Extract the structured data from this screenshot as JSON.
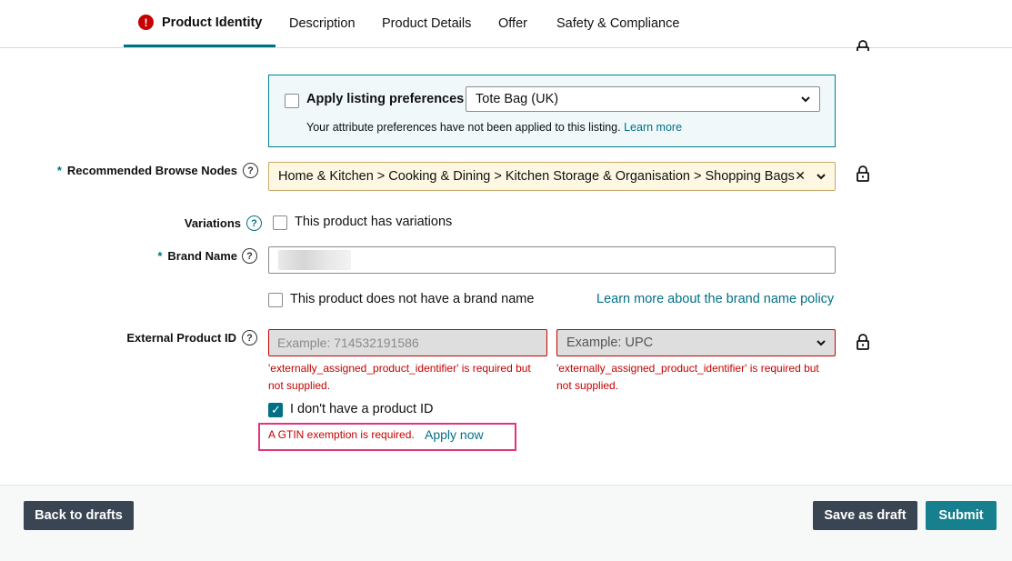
{
  "tabs": [
    {
      "label": "Product Identity",
      "active": true,
      "has_error": true
    },
    {
      "label": "Description"
    },
    {
      "label": "Product Details"
    },
    {
      "label": "Offer"
    },
    {
      "label": "Safety & Compliance"
    }
  ],
  "tab_error_glyph": "!",
  "preferences": {
    "checkbox_label": "Apply listing preferences",
    "selected": "Tote Bag (UK)",
    "note": "Your attribute preferences have not been applied to this listing.",
    "learn_more": "Learn more"
  },
  "browse_nodes": {
    "label": "Recommended Browse Nodes",
    "required_mark": "*",
    "value": "Home & Kitchen > Cooking & Dining > Kitchen Storage & Organisation > Shopping Bags",
    "clear_glyph": "✕"
  },
  "variations": {
    "label": "Variations",
    "checkbox_label": "This product has variations"
  },
  "brand": {
    "label": "Brand Name",
    "required_mark": "*",
    "no_brand_label": "This product does not have a brand name",
    "policy_link": "Learn more about the brand name policy"
  },
  "external_id": {
    "label": "External Product ID",
    "id_placeholder": "Example: 714532191586",
    "type_placeholder": "Example: UPC",
    "error_line1": "'externally_assigned_product_identifier' is required but",
    "error_line2": "not supplied.",
    "no_id_label": "I don't have a product ID",
    "no_id_checked": true,
    "gtin_message": "A GTIN exemption is required.",
    "apply_now": "Apply now"
  },
  "help_glyph": "?",
  "footer": {
    "back": "Back to drafts",
    "save": "Save as draft",
    "submit": "Submit"
  },
  "colors": {
    "accent": "#007185",
    "error": "#c40000",
    "highlight": "#e3347f",
    "dark_button": "#3a4553",
    "teal_button": "#16808e"
  }
}
